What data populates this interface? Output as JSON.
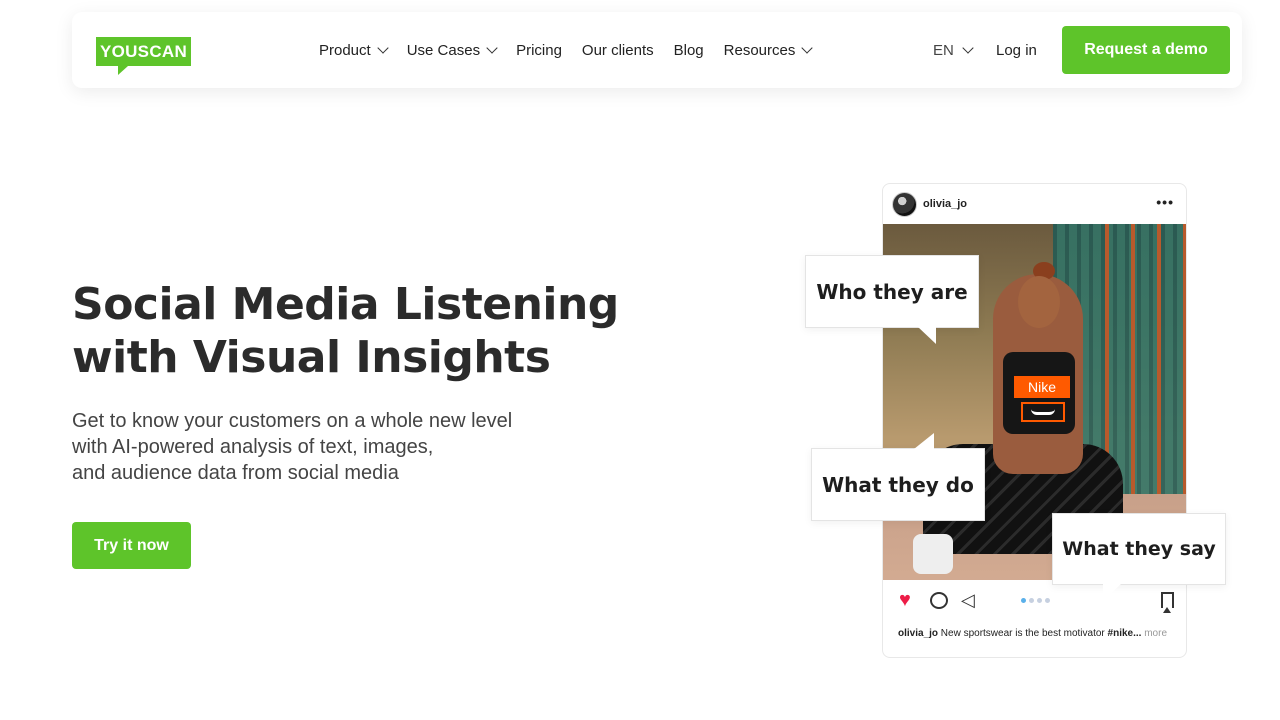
{
  "header": {
    "logo_text": "YOUSCAN",
    "nav": [
      {
        "label": "Product",
        "dropdown": true
      },
      {
        "label": "Use Cases",
        "dropdown": true
      },
      {
        "label": "Pricing",
        "dropdown": false
      },
      {
        "label": "Our clients",
        "dropdown": false
      },
      {
        "label": "Blog",
        "dropdown": false
      },
      {
        "label": "Resources",
        "dropdown": true
      }
    ],
    "language": "EN",
    "login_label": "Log in",
    "demo_label": "Request a demo"
  },
  "hero": {
    "title_line1": "Social Media Listening",
    "title_line2": "with Visual Insights",
    "subtitle_lines": [
      "Get to know your customers on a whole new level",
      "with AI-powered analysis of text, images,",
      "and audience data from social media"
    ],
    "cta_label": "Try it now"
  },
  "post": {
    "username": "olivia_jo",
    "more_menu": "•••",
    "brand_tag": "Nike",
    "caption_user": "olivia_jo",
    "caption_text": "New sportswear is the best motivator",
    "caption_hashtag": "#nike...",
    "caption_more": "more"
  },
  "bubbles": {
    "who": "Who they are",
    "what_do": "What they do",
    "what_say": "What they say"
  },
  "colors": {
    "brand_green": "#5ec42a",
    "heart_red": "#ed1c47",
    "nike_orange": "#ff5a00"
  }
}
